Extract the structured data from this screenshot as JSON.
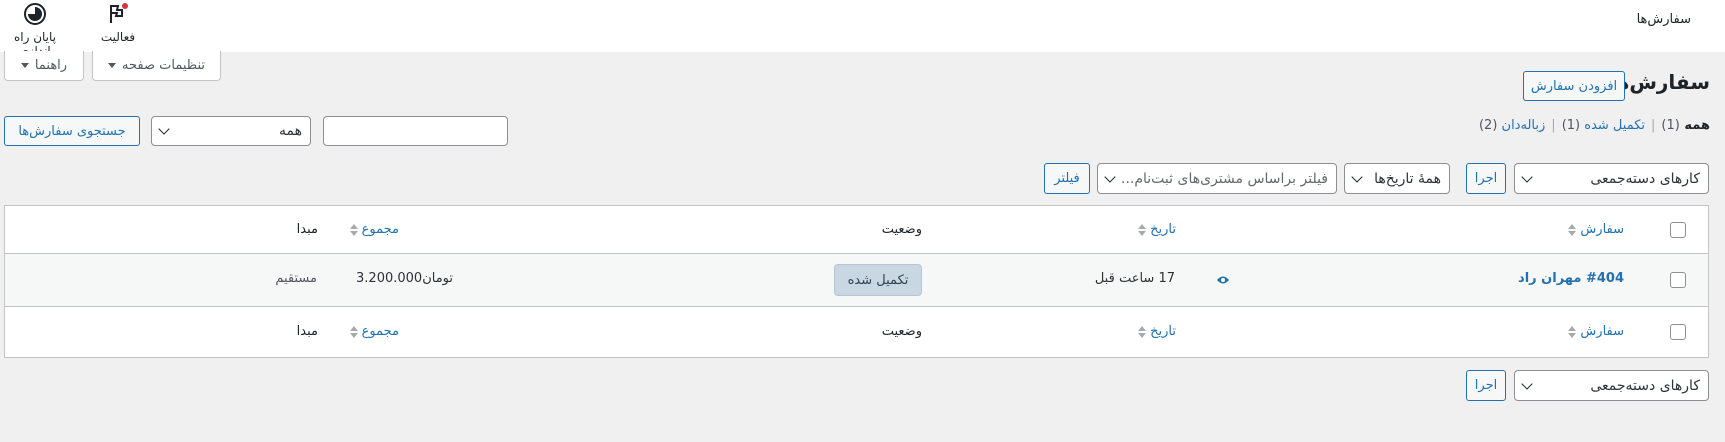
{
  "topbar": {
    "page_label": "سفارش‌ها",
    "activity_label": "فعالیت",
    "finish_setup_label": "پایان راه اندازی"
  },
  "screen_meta": {
    "screen_options_label": "تنظیمات صفحه",
    "help_label": "راهنما"
  },
  "header": {
    "title": "سفارش‌ها",
    "add_order_label": "افزودن سفارش"
  },
  "views": {
    "all_label": "همه",
    "all_count": "(1)",
    "completed_label": "تکمیل شده",
    "completed_count": "(1)",
    "trash_label": "زباله‌دان",
    "trash_count": "(2)",
    "separator": "|"
  },
  "search": {
    "input_value": "",
    "status_select_value": "همه",
    "search_button_label": "جستجوی سفارش‌ها"
  },
  "tablenav_top": {
    "bulk_actions_value": "کارهای دسته‌جمعی",
    "apply_label": "اجرا",
    "dates_value": "همهٔ تاریخ‌ها",
    "customer_filter_placeholder": "فیلتر براساس مشتری‌های ثبت‌نام...",
    "filter_label": "فیلتر"
  },
  "table": {
    "columns": {
      "order": "سفارش",
      "date": "تاریخ",
      "status": "وضعیت",
      "total": "مجموع",
      "origin": "مبدا"
    },
    "rows": [
      {
        "order": "#404 مهران راد",
        "date": "17 ساعت قبل",
        "status": "تکمیل شده",
        "total": "3.200.000تومان",
        "origin": "مستقیم"
      }
    ]
  },
  "tablenav_bottom": {
    "bulk_actions_value": "کارهای دسته‌جمعی",
    "apply_label": "اجرا"
  },
  "colors": {
    "accent": "#2271b1",
    "status_completed_bg": "#c8d7e1",
    "status_completed_text": "#2e4453",
    "notification_dot": "#d63638"
  }
}
